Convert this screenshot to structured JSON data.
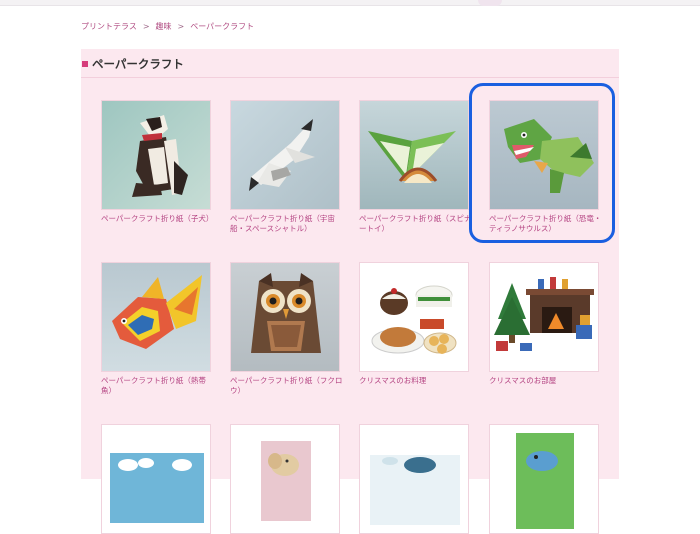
{
  "breadcrumb": [
    {
      "label": "プリントテラス"
    },
    {
      "label": "趣味"
    },
    {
      "label": "ペーパークラフト"
    }
  ],
  "breadcrumb_separator": ">",
  "section": {
    "title": "ペーパークラフト"
  },
  "items": [
    {
      "title": "ペーパークラフト折り紙（子犬）",
      "icon": "paper-dog-image"
    },
    {
      "title": "ペーパークラフト折り紙（宇宙船・スペースシャトル）",
      "icon": "paper-space-shuttle-image"
    },
    {
      "title": "ペーパークラフト折り紙（スピナートイ）",
      "icon": "paper-spinner-toy-image"
    },
    {
      "title": "ペーパークラフト折り紙（恐竜・ティラノサウルス）",
      "icon": "paper-tyrannosaurus-image"
    },
    {
      "title": "ペーパークラフト折り紙（熱帯魚）",
      "icon": "paper-tropical-fish-image"
    },
    {
      "title": "ペーパークラフト折り紙（フクロウ）",
      "icon": "paper-owl-image"
    },
    {
      "title": "クリスマスのお料理",
      "icon": "christmas-dinner-image"
    },
    {
      "title": "クリスマスのお部屋",
      "icon": "christmas-room-image"
    },
    {
      "title": "",
      "icon": "sky-clouds-image"
    },
    {
      "title": "",
      "icon": "elephant-card-image"
    },
    {
      "title": "",
      "icon": "cloud-craft-image"
    },
    {
      "title": "",
      "icon": "green-craft-image"
    }
  ],
  "highlighted_item": "ペーパークラフト折り紙（恐竜・ティラノサウルス）",
  "colors": {
    "panel": "#fce8ef",
    "link": "#b44382",
    "accent": "#d63c7a",
    "highlight": "#1a5fe0"
  }
}
